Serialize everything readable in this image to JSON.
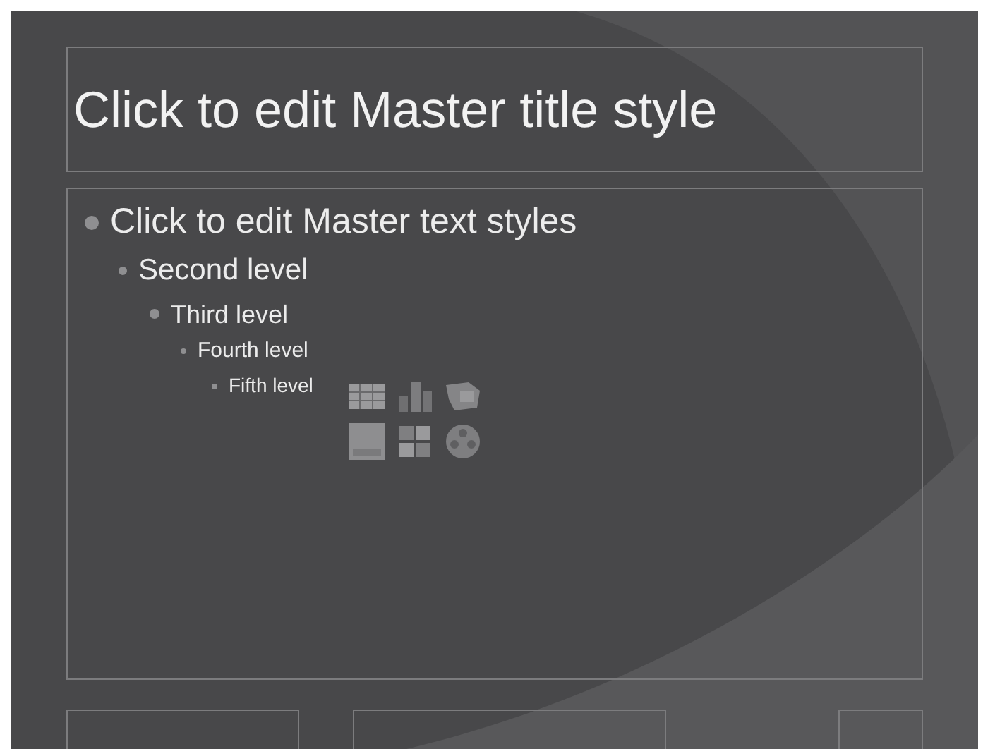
{
  "title_placeholder": {
    "text": "Click to edit Master title style"
  },
  "body_placeholder": {
    "levels": [
      {
        "text": "Click to edit Master text styles",
        "children": [
          {
            "text": "Second level",
            "children": [
              {
                "text": "Third level",
                "children": [
                  {
                    "text": "Fourth level",
                    "children": [
                      {
                        "text": "Fifth level"
                      }
                    ]
                  }
                ]
              }
            ]
          }
        ]
      }
    ]
  }
}
